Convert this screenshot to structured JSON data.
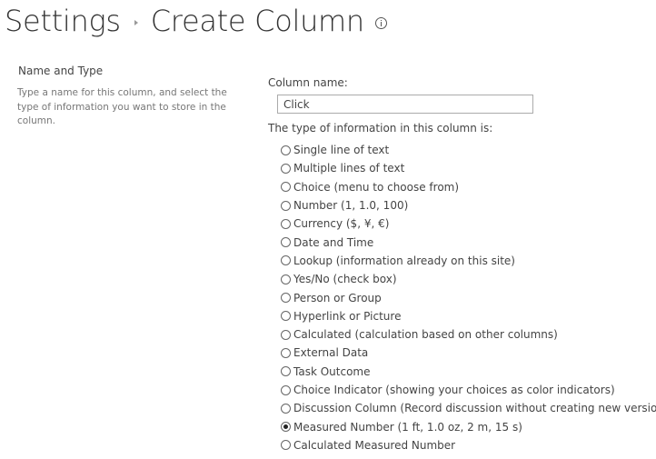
{
  "header": {
    "breadcrumb_root": "Settings",
    "page_title": "Create Column"
  },
  "section": {
    "title": "Name and Type",
    "description": "Type a name for this column, and select the type of information you want to store in the column."
  },
  "column_name": {
    "label": "Column name:",
    "value": "Click"
  },
  "type_question": "The type of information in this column is:",
  "types": [
    {
      "label": "Single line of text",
      "checked": false
    },
    {
      "label": "Multiple lines of text",
      "checked": false
    },
    {
      "label": "Choice (menu to choose from)",
      "checked": false
    },
    {
      "label": "Number (1, 1.0, 100)",
      "checked": false
    },
    {
      "label": "Currency ($, ¥, €)",
      "checked": false
    },
    {
      "label": "Date and Time",
      "checked": false
    },
    {
      "label": "Lookup (information already on this site)",
      "checked": false
    },
    {
      "label": "Yes/No (check box)",
      "checked": false
    },
    {
      "label": "Person or Group",
      "checked": false
    },
    {
      "label": "Hyperlink or Picture",
      "checked": false
    },
    {
      "label": "Calculated (calculation based on other columns)",
      "checked": false
    },
    {
      "label": "External Data",
      "checked": false
    },
    {
      "label": "Task Outcome",
      "checked": false
    },
    {
      "label": "Choice Indicator (showing your choices as color indicators)",
      "checked": false
    },
    {
      "label": "Discussion Column (Record discussion without creating new version)",
      "checked": false
    },
    {
      "label": "Measured Number (1 ft, 1.0 oz, 2 m, 15 s)",
      "checked": true
    },
    {
      "label": "Calculated Measured Number",
      "checked": false
    }
  ]
}
